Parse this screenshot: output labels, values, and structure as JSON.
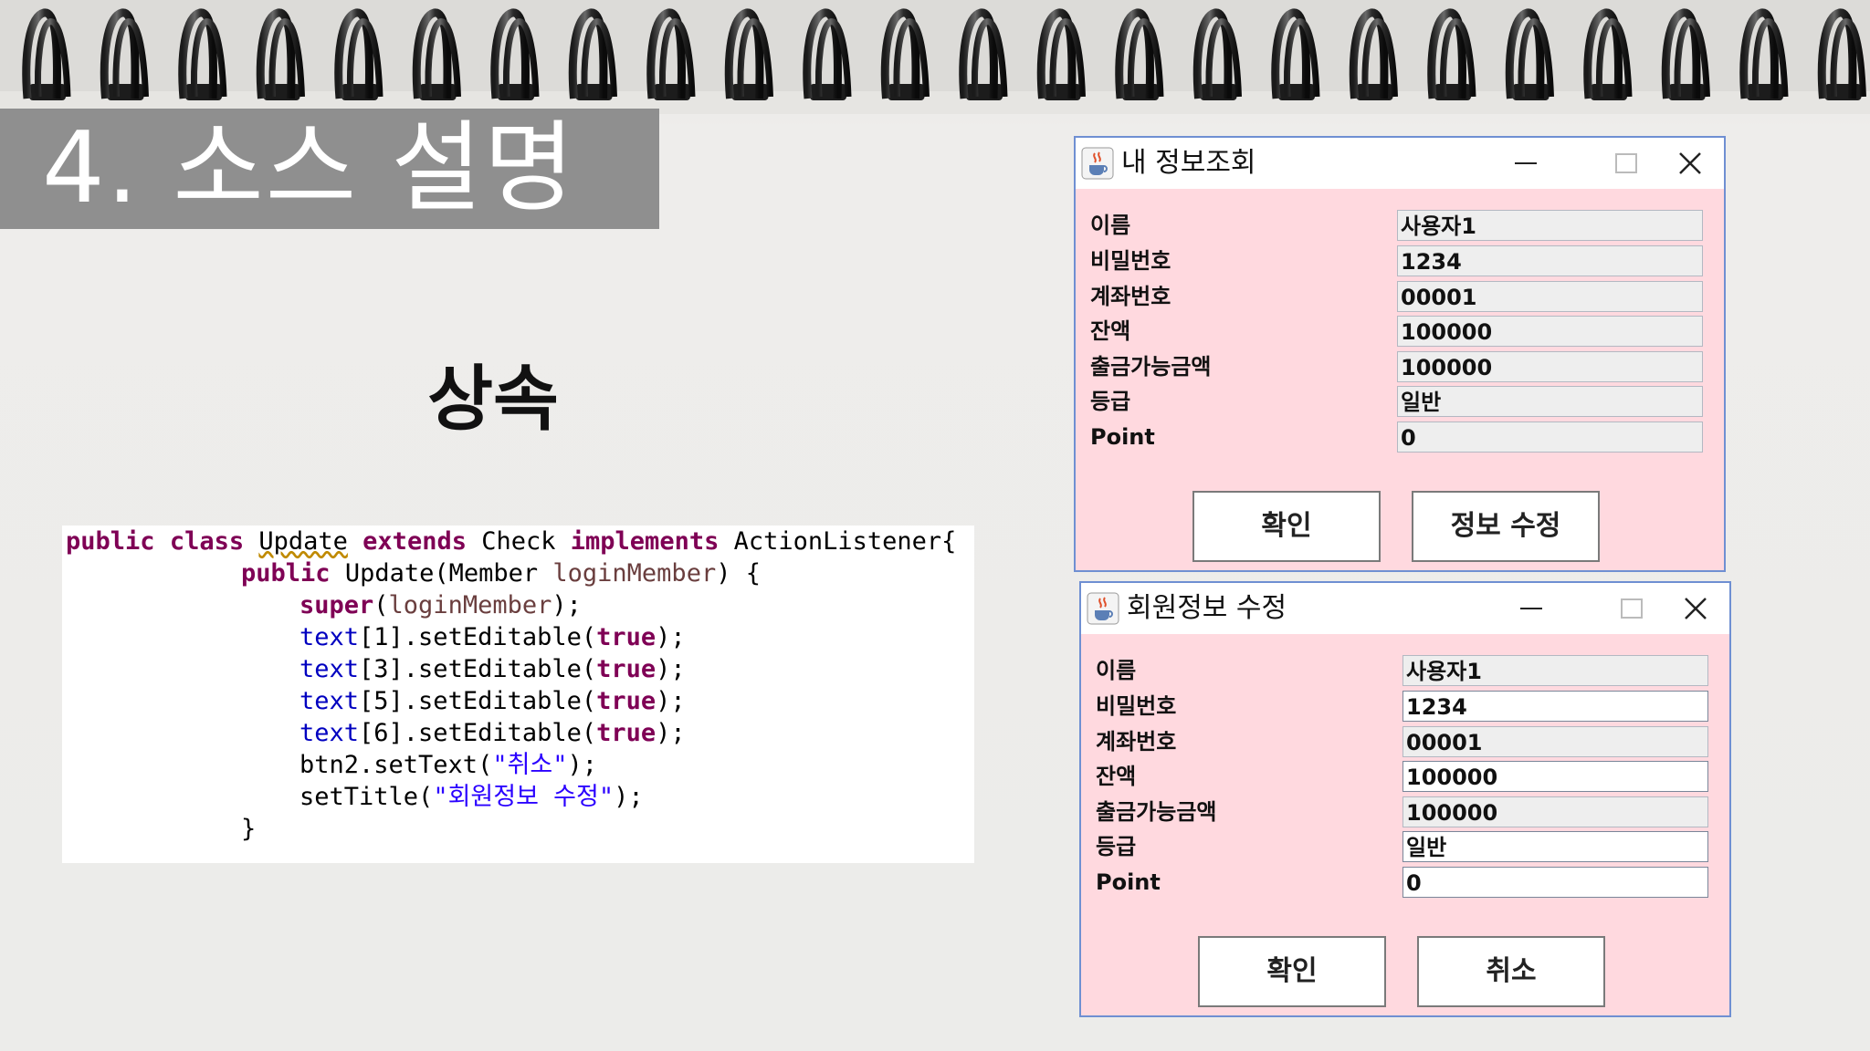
{
  "slide": {
    "title": "4. 소스 설명",
    "subtitle": "상속"
  },
  "code": {
    "line1": {
      "kw1": "public",
      "kw2": "class",
      "name": "Update",
      "kw3": "extends",
      "parent": "Check",
      "kw4": "implements",
      "iface": "ActionListener{"
    },
    "line2": {
      "kw": "public",
      "sig": "Update(Member ",
      "param": "loginMember",
      "tail": ") {"
    },
    "line3": {
      "kw": "super",
      "open": "(",
      "param": "loginMember",
      "tail": ");"
    },
    "line4": {
      "field": "text",
      "idx": "[1].setEditable(",
      "val": "true",
      "tail": ");"
    },
    "line5": {
      "field": "text",
      "idx": "[3].setEditable(",
      "val": "true",
      "tail": ");"
    },
    "line6": {
      "field": "text",
      "idx": "[5].setEditable(",
      "val": "true",
      "tail": ");"
    },
    "line7": {
      "field": "text",
      "idx": "[6].setEditable(",
      "val": "true",
      "tail": ");"
    },
    "line8": {
      "pre": "btn2.setText(",
      "str": "\"취소\"",
      "tail": ");"
    },
    "line9": {
      "pre": "setTitle(",
      "str": "\"회원정보 수정\"",
      "tail": ");"
    },
    "line10": "}"
  },
  "window_info": {
    "title": "내 정보조회",
    "icon": "java-cup-icon",
    "labels": [
      "이름",
      "비밀번호",
      "계좌번호",
      "잔액",
      "출금가능금액",
      "등급",
      "Point"
    ],
    "values": [
      "사용자1",
      "1234",
      "00001",
      "100000",
      "100000",
      "일반",
      "0"
    ],
    "buttons": [
      "확인",
      "정보 수정"
    ]
  },
  "window_edit": {
    "title": "회원정보 수정",
    "icon": "java-cup-icon",
    "labels": [
      "이름",
      "비밀번호",
      "계좌번호",
      "잔액",
      "출금가능금액",
      "등급",
      "Point"
    ],
    "values": [
      "사용자1",
      "1234",
      "00001",
      "100000",
      "100000",
      "일반",
      "0"
    ],
    "editable": [
      false,
      true,
      false,
      true,
      false,
      true,
      true
    ],
    "buttons": [
      "확인",
      "취소"
    ]
  },
  "colors": {
    "window_bg": "#ffd9df",
    "title_box": "#8f8f8f",
    "keyword": "#7f0055",
    "field": "#0000c0",
    "string": "#2a00ff"
  }
}
